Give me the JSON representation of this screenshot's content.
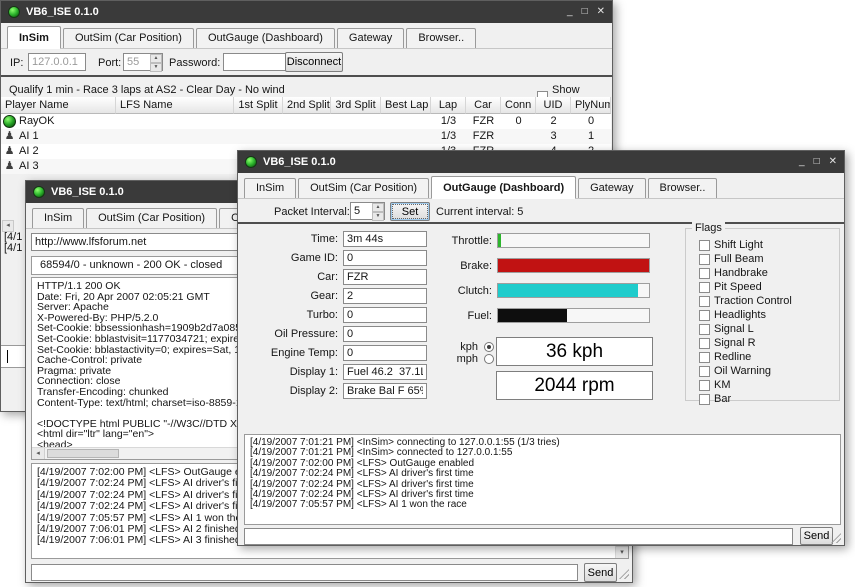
{
  "app": {
    "title": "VB6_ISE 0.1.0"
  },
  "tabs": [
    "InSim",
    "OutSim (Car Position)",
    "OutGauge (Dashboard)",
    "Gateway",
    "Browser.."
  ],
  "window_controls": {
    "minimize": "_",
    "maximize": "□",
    "close": "✕"
  },
  "colors": {
    "titlebar": "#3a3a3a",
    "throttle_green": "#2db52d",
    "brake_red": "#c11212",
    "clutch_cyan": "#1fcccc",
    "fuel_black": "#0e0e0e"
  },
  "w1": {
    "conn_bar": {
      "ip_label": "IP:",
      "ip_value": "127.0.0.1",
      "port_label": "Port:",
      "port_value": "55",
      "password_label": "Password:",
      "password_value": "",
      "disconnect_label": "Disconnect"
    },
    "status_text": "Qualify 1 min - Race 3 laps at AS2 - Clear Day - No wind",
    "show_states_label": "Show States",
    "table": {
      "columns": [
        "Player Name",
        "LFS Name",
        "1st Split",
        "2nd Split",
        "3rd Split",
        "Best Lap",
        "Lap",
        "Car",
        "Conn",
        "UID",
        "PlyNum"
      ],
      "rows": [
        {
          "icon": "player",
          "name": "RayOK",
          "lfs_name": "",
          "split1": "",
          "split2": "",
          "split3": "",
          "best_lap": "",
          "lap": "1/3",
          "car": "FZR",
          "conn": "0",
          "uid": "2",
          "plynum": "0"
        },
        {
          "icon": "ai",
          "name": "AI 1",
          "lfs_name": "",
          "split1": "",
          "split2": "",
          "split3": "",
          "best_lap": "",
          "lap": "1/3",
          "car": "FZR",
          "conn": "",
          "uid": "3",
          "plynum": "1"
        },
        {
          "icon": "ai",
          "name": "AI 2",
          "lfs_name": "",
          "split1": "",
          "split2": "",
          "split3": "",
          "best_lap": "",
          "lap": "1/3",
          "car": "FZR",
          "conn": "",
          "uid": "4",
          "plynum": "2"
        },
        {
          "icon": "ai",
          "name": "AI 3",
          "lfs_name": "",
          "split1": "",
          "split2": "",
          "split3": "",
          "best_lap": "",
          "lap": "",
          "car": "",
          "conn": "",
          "uid": "",
          "plynum": ""
        }
      ]
    },
    "scroll_arrow": "◂",
    "log_fragments": [
      "[4/1",
      "[4/1"
    ]
  },
  "w2": {
    "url_value": "http://www.lfsforum.net",
    "connection_item": "68594/0 - unknown - 200 OK - closed",
    "response_lines": [
      "HTTP/1.1 200 OK",
      "Date: Fri, 20 Apr 2007 02:05:21 GMT",
      "Server: Apache",
      "X-Powered-By: PHP/5.2.0",
      "Set-Cookie: bbsessionhash=1909b2d7a0857f59904ba5",
      "Set-Cookie: bblastvisit=1177034721; expires=Sat, 19-",
      "Set-Cookie: bblastactivity=0; expires=Sat, 19-Apr-200",
      "Cache-Control: private",
      "Pragma: private",
      "Connection: close",
      "Transfer-Encoding: chunked",
      "Content-Type: text/html; charset=iso-8859-1",
      "",
      "<!DOCTYPE html PUBLIC \"-//W3C//DTD XHTML 1.0 Tra",
      "<html dir=\"ltr\" lang=\"en\">",
      "<head>"
    ],
    "scroll_left_arrow": "◂",
    "scroll_down_arrow": "▾",
    "log_lines": [
      "[4/19/2007 7:02:00 PM] <LFS> OutGauge enabled",
      "[4/19/2007 7:02:24 PM] <LFS> AI driver's first time",
      "[4/19/2007 7:02:24 PM] <LFS> AI driver's first time",
      "[4/19/2007 7:02:24 PM] <LFS> AI driver's first time",
      "[4/19/2007 7:05:57 PM] <LFS> AI 1 won the race",
      "[4/19/2007 7:06:01 PM] <LFS> AI 2 finished 2nd",
      "[4/19/2007 7:06:01 PM] <LFS> AI 3 finished 3rd"
    ],
    "input_value": "",
    "send_label": "Send"
  },
  "w3": {
    "packet": {
      "label": "Packet Interval:",
      "value": "5",
      "set_label": "Set",
      "current_text": "Current interval: 5"
    },
    "fields": [
      {
        "label": "Time:",
        "value": "3m 44s"
      },
      {
        "label": "Game ID:",
        "value": "0"
      },
      {
        "label": "Car:",
        "value": "FZR"
      },
      {
        "label": "Gear:",
        "value": "2"
      },
      {
        "label": "Turbo:",
        "value": "0"
      },
      {
        "label": "Oil Pressure:",
        "value": "0"
      },
      {
        "label": "Engine Temp:",
        "value": "0"
      },
      {
        "label": "Display 1:",
        "value": "Fuel 46.2  37.1L"
      },
      {
        "label": "Display 2:",
        "value": "Brake Bal F 65%"
      }
    ],
    "bars": [
      {
        "label": "Throttle:",
        "percent": 2,
        "color": "#2db52d"
      },
      {
        "label": "Brake:",
        "percent": 100,
        "color": "#c11212"
      },
      {
        "label": "Clutch:",
        "percent": 93,
        "color": "#1fcccc"
      },
      {
        "label": "Fuel:",
        "percent": 46,
        "color": "#0e0e0e"
      }
    ],
    "units": {
      "kph_label": "kph",
      "mph_label": "mph",
      "selected": "kph"
    },
    "speed_display": "36 kph",
    "rpm_display": "2044 rpm",
    "flags": {
      "title": "Flags",
      "items": [
        "Shift Light",
        "Full Beam",
        "Handbrake",
        "Pit Speed",
        "Traction Control",
        "Headlights",
        "Signal L",
        "Signal R",
        "Redline",
        "Oil Warning",
        "KM",
        "Bar"
      ]
    },
    "log_lines": [
      "[4/19/2007 7:01:21 PM] <InSim> connecting to 127.0.0.1:55 (1/3 tries)",
      "[4/19/2007 7:01:21 PM] <InSim> connected to 127.0.0.1:55",
      "[4/19/2007 7:02:00 PM] <LFS> OutGauge enabled",
      "[4/19/2007 7:02:24 PM] <LFS> AI driver's first time",
      "[4/19/2007 7:02:24 PM] <LFS> AI driver's first time",
      "[4/19/2007 7:02:24 PM] <LFS> AI driver's first time",
      "[4/19/2007 7:05:57 PM] <LFS> AI 1 won the race"
    ],
    "input_value": "",
    "send_label": "Send"
  }
}
